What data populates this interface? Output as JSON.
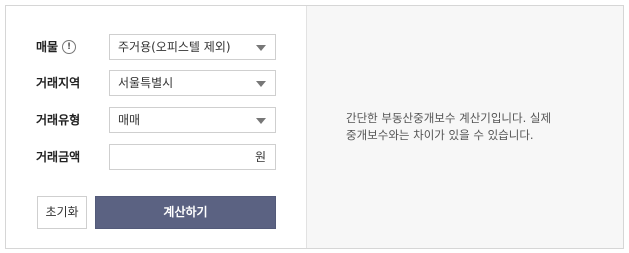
{
  "form": {
    "property": {
      "label": "매물",
      "info_icon": "!",
      "value": "주거용(오피스텔 제외)"
    },
    "region": {
      "label": "거래지역",
      "value": "서울특별시"
    },
    "type": {
      "label": "거래유형",
      "value": "매매"
    },
    "amount": {
      "label": "거래금액",
      "value": "",
      "unit": "원"
    }
  },
  "buttons": {
    "reset": "초기화",
    "calculate": "계산하기"
  },
  "description": {
    "line1": "간단한 부동산중개보수 계산기입니다. 실제",
    "line2": "중개보수와는 차이가 있을 수 있습니다."
  },
  "colors": {
    "primary_button": "#5b6282",
    "right_panel_bg": "#f7f7f7"
  }
}
